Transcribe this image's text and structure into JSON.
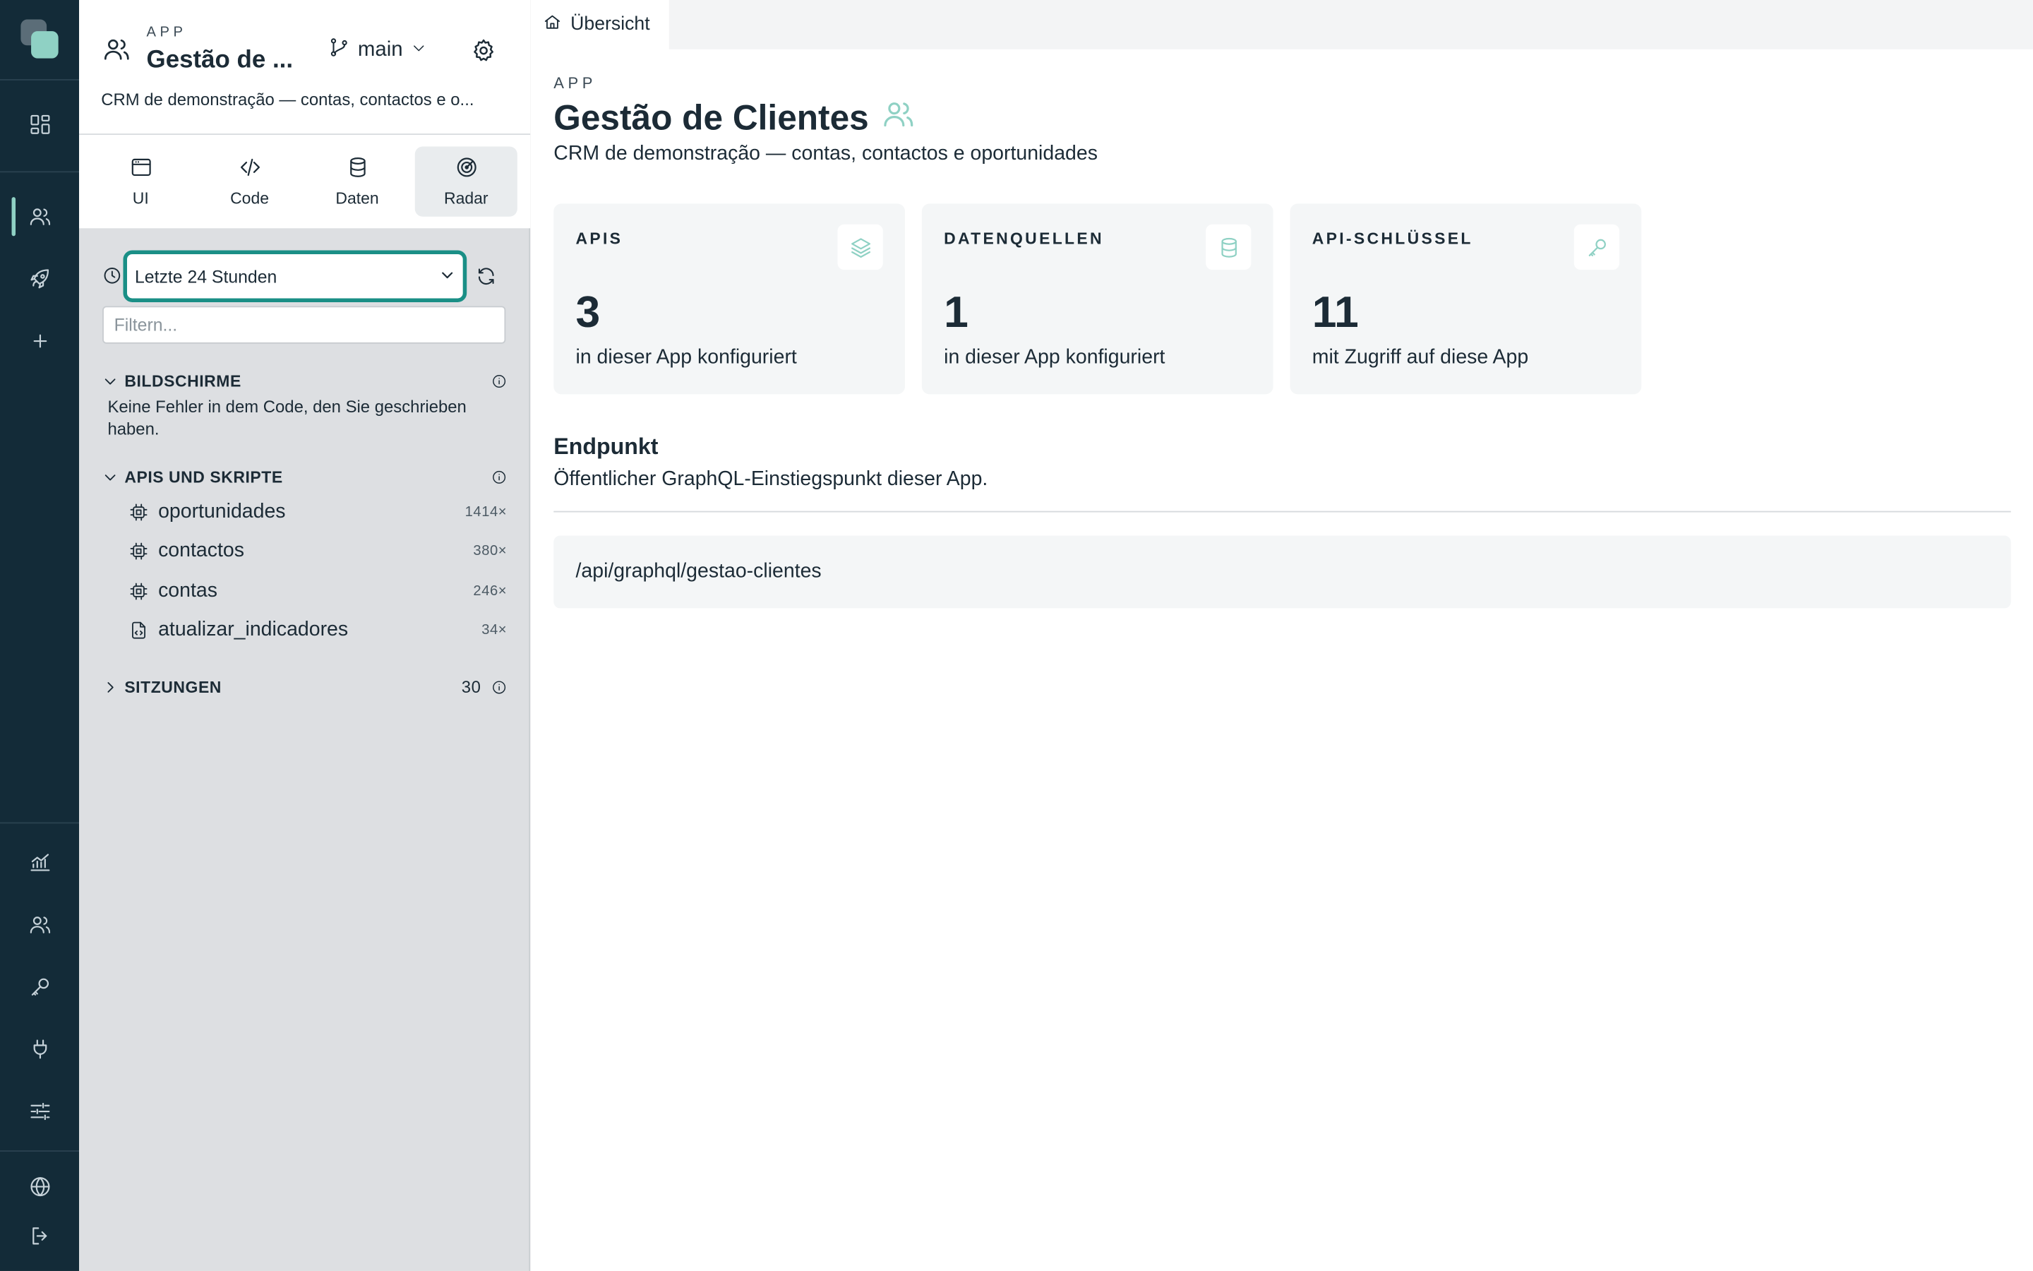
{
  "app": {
    "eyebrow": "APP",
    "title_short": "Gestão de ...",
    "title": "Gestão de Clientes",
    "description_short": "CRM de demonstração — contas, contactos e o...",
    "description": "CRM de demonstração — contas, contactos e oportunidades",
    "branch": "main"
  },
  "tabs": [
    {
      "label": "UI",
      "icon": "browser-window-icon"
    },
    {
      "label": "Code",
      "icon": "code-icon"
    },
    {
      "label": "Daten",
      "icon": "database-icon"
    },
    {
      "label": "Radar",
      "icon": "radar-icon",
      "active": true
    }
  ],
  "radar": {
    "time_range": "Letzte 24 Stunden",
    "filter_placeholder": "Filtern...",
    "screens": {
      "title": "BILDSCHIRME",
      "empty": "Keine Fehler in dem Code, den Sie geschrieben haben."
    },
    "apis": {
      "title": "APIS UND SKRIPTE",
      "items": [
        {
          "name": "oportunidades",
          "count": "1414×",
          "icon": "cpu-icon"
        },
        {
          "name": "contactos",
          "count": "380×",
          "icon": "cpu-icon"
        },
        {
          "name": "contas",
          "count": "246×",
          "icon": "cpu-icon"
        },
        {
          "name": "atualizar_indicadores",
          "count": "34×",
          "icon": "script-file-icon"
        }
      ]
    },
    "sessions": {
      "title": "SITZUNGEN",
      "count": "30"
    }
  },
  "main": {
    "tab": "Übersicht",
    "cards": [
      {
        "label": "APIS",
        "value": "3",
        "sub": "in dieser App konfiguriert",
        "icon": "layers-icon"
      },
      {
        "label": "DATENQUELLEN",
        "value": "1",
        "sub": "in dieser App konfiguriert",
        "icon": "database-icon"
      },
      {
        "label": "API-SCHLÜSSEL",
        "value": "11",
        "sub": "mit Zugriff auf diese App",
        "icon": "key-icon"
      }
    ],
    "endpoint": {
      "title": "Endpunkt",
      "description": "Öffentlicher GraphQL-Einstiegspunkt dieser App.",
      "path": "/api/graphql/gestao-clientes"
    }
  },
  "colors": {
    "rail": "#132b38",
    "accent": "#8fd1c4",
    "focus": "#1a8f86",
    "panel": "#dddfe2",
    "card": "#f4f6f7"
  }
}
